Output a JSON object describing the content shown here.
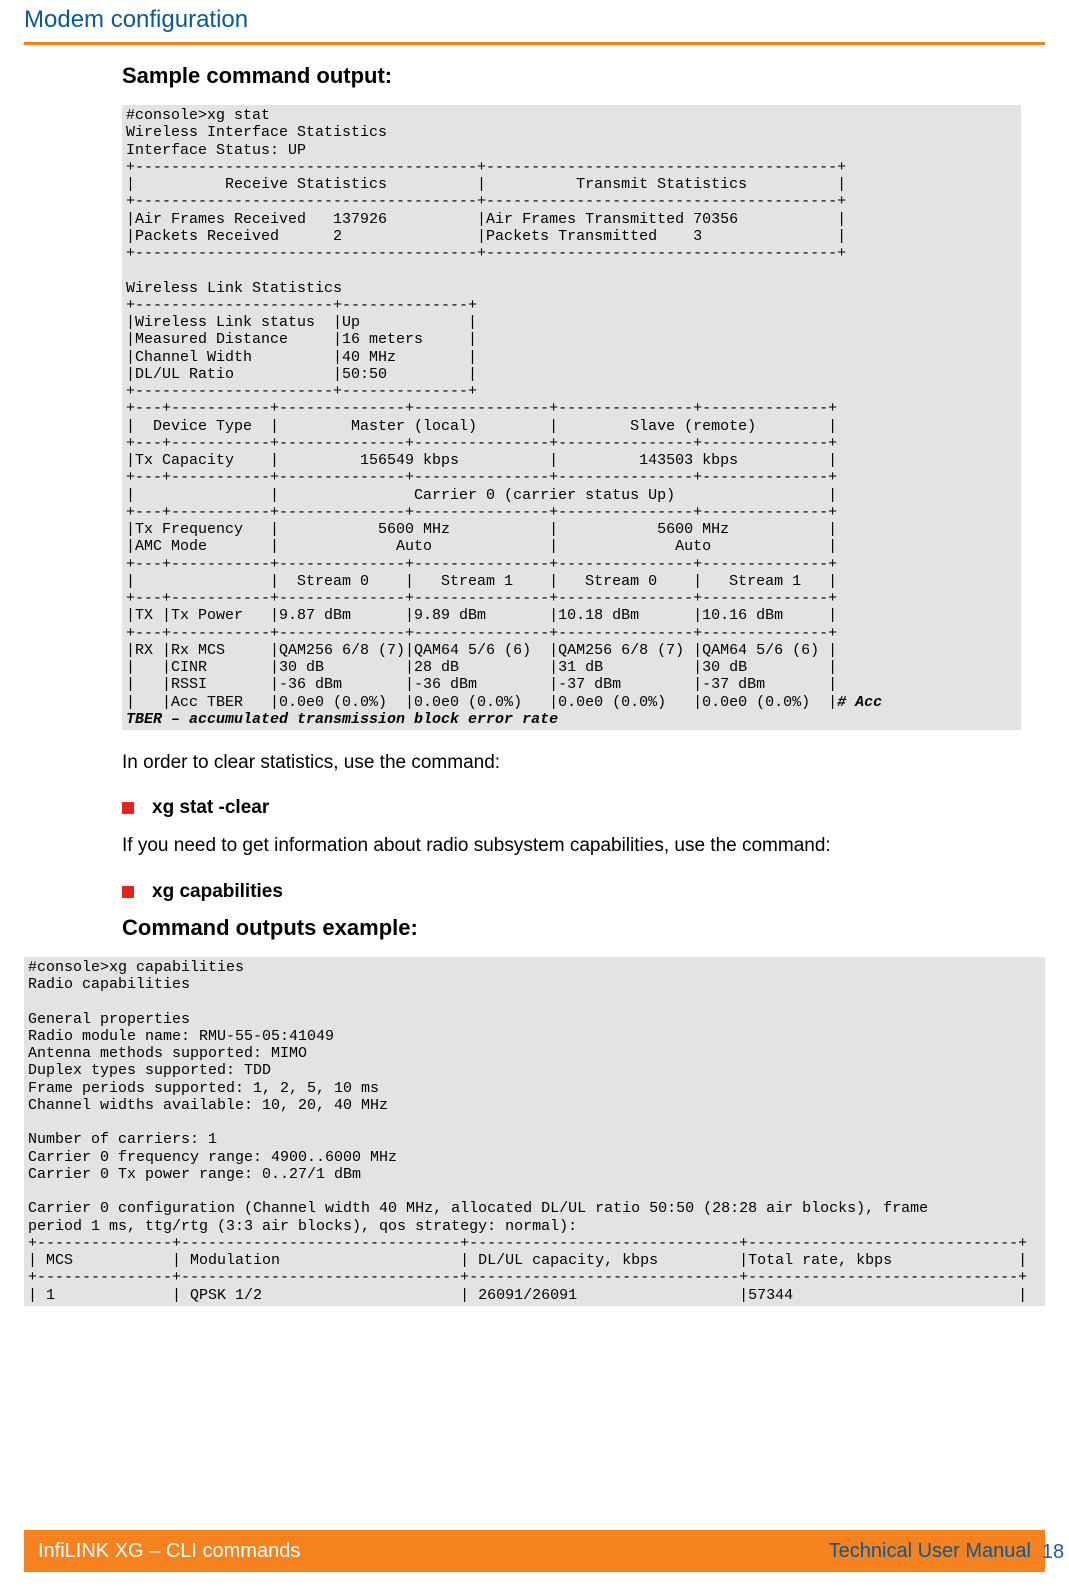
{
  "header": {
    "title": "Modem configuration"
  },
  "section1_title": "Sample command output:",
  "code1_line1": "#console>xg stat",
  "code1_line2": "Wireless Interface Statistics",
  "code1_line3": "Interface Status: UP",
  "code1_line4": "+--------------------------------------+---------------------------------------+",
  "code1_line5": "|          Receive Statistics          |          Transmit Statistics          |",
  "code1_line6": "+--------------------------------------+---------------------------------------+",
  "code1_line7": "|Air Frames Received   137926          |Air Frames Transmitted 70356           |",
  "code1_line8": "|Packets Received      2               |Packets Transmitted    3               |",
  "code1_line9": "+--------------------------------------+---------------------------------------+",
  "code1_line10": "",
  "code1_line11": "Wireless Link Statistics",
  "code1_line12": "+----------------------+--------------+",
  "code1_line13": "|Wireless Link status  |Up            |",
  "code1_line14": "|Measured Distance     |16 meters     |",
  "code1_line15": "|Channel Width         |40 MHz        |",
  "code1_line16": "|DL/UL Ratio           |50:50         |",
  "code1_line17": "+----------------------+--------------+",
  "code1_line18": "+---+-----------+--------------+---------------+---------------+--------------+",
  "code1_line19": "|  Device Type  |        Master (local)        |        Slave (remote)        |",
  "code1_line20": "+---+-----------+--------------+---------------+---------------+--------------+",
  "code1_line21": "|Tx Capacity    |         156549 kbps          |         143503 kbps          |",
  "code1_line22": "+---+-----------+--------------+---------------+---------------+--------------+",
  "code1_line23": "|               |               Carrier 0 (carrier status Up)                 |",
  "code1_line24": "+---+-----------+--------------+---------------+---------------+--------------+",
  "code1_line25": "|Tx Frequency   |           5600 MHz           |           5600 MHz           |",
  "code1_line26": "|AMC Mode       |             Auto             |             Auto             |",
  "code1_line27": "+---+-----------+--------------+---------------+---------------+--------------+",
  "code1_line28": "|               |  Stream 0    |   Stream 1    |   Stream 0    |   Stream 1   |",
  "code1_line29": "+---+-----------+--------------+---------------+---------------+--------------+",
  "code1_line30": "|TX |Tx Power   |9.87 dBm      |9.89 dBm       |10.18 dBm      |10.16 dBm     |",
  "code1_line31": "+---+-----------+--------------+---------------+---------------+--------------+",
  "code1_line32": "|RX |Rx MCS     |QAM256 6/8 (7)|QAM64 5/6 (6)  |QAM256 6/8 (7) |QAM64 5/6 (6) |",
  "code1_line33": "|   |CINR       |30 dB         |28 dB          |31 dB          |30 dB         |",
  "code1_line34": "|   |RSSI       |-36 dBm       |-36 dBm        |-37 dBm        |-37 dBm       |",
  "code1_line35a": "|   |Acc TBER   |0.0e0 (0.0%)  |0.0e0 (0.0%)   |0.0e0 (0.0%)   |0.0e0 (0.0%)  |",
  "code1_line35b": "# Acc",
  "code1_line36": "TBER – accumulated transmission block error rate",
  "para1": "In order to clear statistics, use the command:",
  "bullet1": "xg stat -clear",
  "para2": "If  you  need  to  get  information  about  radio  subsystem  capabilities,  use  the command:",
  "bullet2": "xg capabilities",
  "section2_title": "Command outputs example:",
  "code2_line1": "#console>xg capabilities",
  "code2_line2": "Radio capabilities",
  "code2_line3": "",
  "code2_line4": "General properties",
  "code2_line5": "Radio module name: RMU-55-05:41049",
  "code2_line6": "Antenna methods supported: MIMO",
  "code2_line7": "Duplex types supported: TDD",
  "code2_line8": "Frame periods supported: 1, 2, 5, 10 ms",
  "code2_line9": "Channel widths available: 10, 20, 40 MHz",
  "code2_line10": "",
  "code2_line11": "Number of carriers: 1",
  "code2_line12": "Carrier 0 frequency range: 4900..6000 MHz",
  "code2_line13": "Carrier 0 Tx power range: 0..27/1 dBm",
  "code2_line14": "",
  "code2_line15": "Carrier 0 configuration (Channel width 40 MHz, allocated DL/UL ratio 50:50 (28:28 air blocks), frame",
  "code2_line16": "period 1 ms, ttg/rtg (3:3 air blocks), qos strategy: normal):",
  "code2_line17": "+---------------+-------------------------------+------------------------------+------------------------------+",
  "code2_line18": "| MCS           | Modulation                    | DL/UL capacity, kbps         |Total rate, kbps              |",
  "code2_line19": "+---------------+-------------------------------+------------------------------+------------------------------+",
  "code2_line20": "| 1             | QPSK 1/2                      | 26091/26091                  |57344                         |",
  "footer": {
    "left": "InfiLINK XG – CLI commands",
    "right": "Technical User Manual"
  },
  "page_number": "18"
}
